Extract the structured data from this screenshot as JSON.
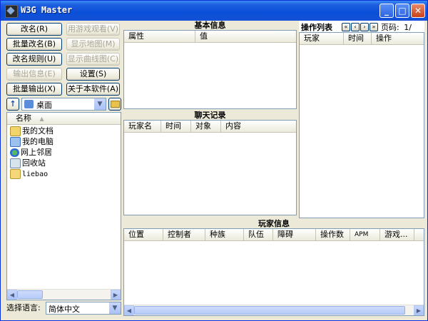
{
  "window": {
    "title": "W3G Master"
  },
  "buttons": {
    "rename": "改名(R)",
    "watch_game": "用游戏观看(V)",
    "batch_rename": "批量改名(B)",
    "show_map": "显示地图(M)",
    "rename_rules": "改名规则(U)",
    "show_curve": "显示曲线图(C)",
    "export_info": "输出信息(E)",
    "settings": "设置(S)",
    "batch_export": "批量输出(X)",
    "about": "关于本软件(A)"
  },
  "folder": {
    "current": "桌面"
  },
  "file_tree": {
    "header": "名称",
    "items": [
      {
        "label": "我的文档",
        "icon": "documents-folder-icon"
      },
      {
        "label": "我的电脑",
        "icon": "computer-icon"
      },
      {
        "label": "网上邻居",
        "icon": "network-icon"
      },
      {
        "label": "回收站",
        "icon": "recycle-bin-icon"
      },
      {
        "label": "liebao",
        "icon": "folder-icon"
      }
    ]
  },
  "language": {
    "label": "选择语言:",
    "value": "简体中文"
  },
  "basic_info": {
    "title": "基本信息",
    "columns": [
      "属性",
      "值"
    ]
  },
  "chat": {
    "title": "聊天记录",
    "columns": [
      "玩家名",
      "时间",
      "对象",
      "内容"
    ]
  },
  "actions": {
    "title": "操作列表",
    "page_label": "页码:",
    "page_value": "1/",
    "columns": [
      "玩家",
      "时间",
      "操作"
    ]
  },
  "players": {
    "title": "玩家信息",
    "columns": [
      "位置",
      "控制者",
      "种族",
      "队伍",
      "障碍",
      "操作数",
      "APM",
      "游戏..."
    ]
  }
}
